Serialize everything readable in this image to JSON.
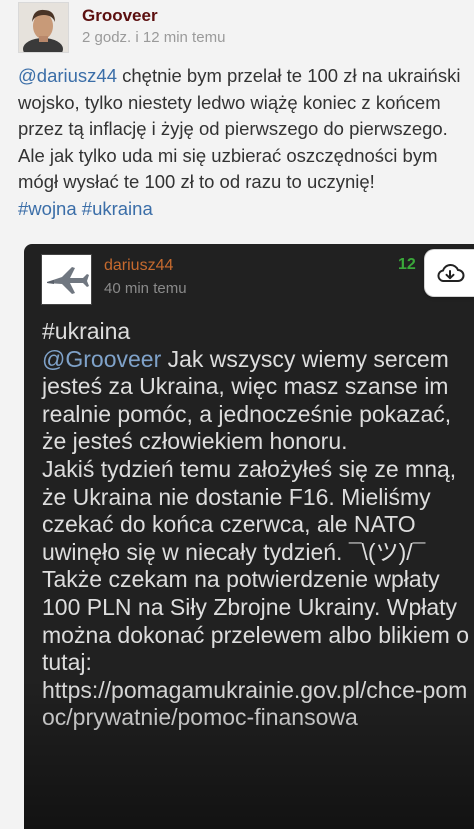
{
  "post": {
    "author": "Grooveer",
    "timestamp": "2 godz. i 12 min temu",
    "mention": "@dariusz44",
    "text": " chętnie bym przelał te 100 zł na ukraiński wojsko, tylko niestety ledwo wiążę koniec z końcem przez tą inflację i żyję od pierwszego do pierwszego. Ale jak tylko uda mi się uzbierać oszczędności bym mógł wysłać te 100 zł to od razu to uczynię!",
    "tags": [
      "#wojna",
      "#ukraina"
    ]
  },
  "embedded": {
    "author": "dariusz44",
    "timestamp": "40 min temu",
    "votes": "12",
    "tag": "#ukraina",
    "mention": "@Grooveer",
    "line1_rest": " Jak wszyscy wiemy sercem jesteś za Ukraina, więc masz szanse im realnie pomóc, a jednocześnie pokazać, że jesteś człowiekiem honoru.",
    "paragraph2": "Jakiś tydzień temu założyłeś się ze mną, że Ukraina nie dostanie F16. Mieliśmy czekać do końca czerwca, ale NATO uwinęło się w niecały tydzień. ¯\\(ツ)/¯",
    "paragraph3": "Także czekam na potwierdzenie wpłaty 100 PLN na Siły Zbrojne Ukrainy. Wpłaty można dokonać przelewem albo blikiem o tutaj:",
    "url": "https://pomagamukrainie.gov.pl/chce-pomoc/prywatnie/pomoc-finansowa"
  },
  "icons": {
    "avatar": "man-portrait-avatar",
    "embedded_avatar": "fighter-jet-avatar",
    "download": "cloud-download-icon"
  },
  "colors": {
    "author": "#5c0f0f",
    "link": "#3b6ea8",
    "embedded_author": "#c66a2e",
    "votes": "#3aa83a",
    "embedded_bg": "#212121"
  }
}
